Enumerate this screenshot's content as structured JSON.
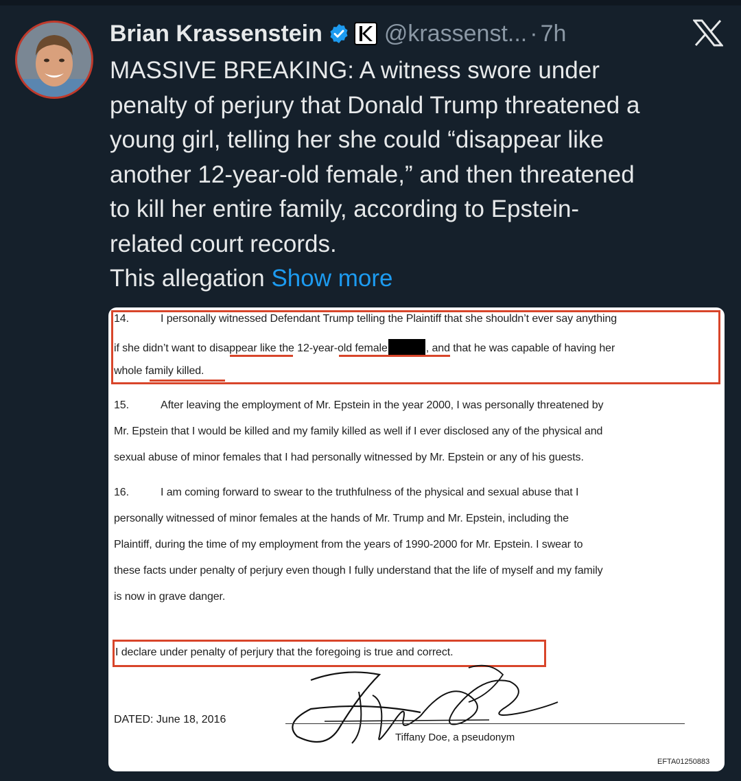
{
  "tweet": {
    "author": "Brian Krassenstein",
    "handle": "@krassenst...",
    "separator": "·",
    "time": "7h",
    "text_lines": [
      "MASSIVE BREAKING: A witness swore under",
      "penalty of perjury that Donald Trump threatened a",
      "young girl, telling her she could “disappear like",
      "another 12-year-old female,” and then threatened",
      "to kill her entire family, according to Epstein-",
      "related court records."
    ],
    "last_line_prefix": "This allegation",
    "show_more": "Show more"
  },
  "document": {
    "p14": {
      "num": "14.",
      "line1": "I personally witnessed Defendant Trump telling the Plaintiff that she shouldn’t ever say anything",
      "line2a": "if she didn’t want to disappear like the 12-year-old female",
      "line2b": ", and that he was capable of having her",
      "line3": "whole family killed."
    },
    "p15": {
      "num": "15.",
      "line1": "After leaving the employment of Mr. Epstein in the year 2000, I was personally threatened by",
      "line2": "Mr. Epstein that I would be killed and my family killed as well if I ever disclosed any of the physical and",
      "line3": "sexual abuse of minor females that I had personally witnessed by Mr. Epstein or any of his guests."
    },
    "p16": {
      "num": "16.",
      "line1": "I am coming forward to swear to the truthfulness of the physical and sexual abuse that I",
      "line2": "personally witnessed of minor females at the hands of Mr. Trump and Mr. Epstein, including the",
      "line3": "Plaintiff, during the time of my employment from the years of 1990-2000 for Mr. Epstein.  I swear to",
      "line4": "these facts under penalty of perjury even though I fully understand that the life of myself and my family",
      "line5": "is now in grave danger."
    },
    "declaration": "I declare under penalty of perjury that the foregoing is true and correct.",
    "dated": "DATED:  June 18, 2016",
    "signer": "Tiffany Doe, a pseudonym",
    "doc_id": "EFTA01250883"
  },
  "colors": {
    "background": "#15202b",
    "link": "#1d9bf0",
    "verified": "#1d9bf0",
    "highlight_box": "#d8452a"
  },
  "icons": [
    "verified-badge-icon",
    "k-badge-icon",
    "x-logo-icon"
  ]
}
